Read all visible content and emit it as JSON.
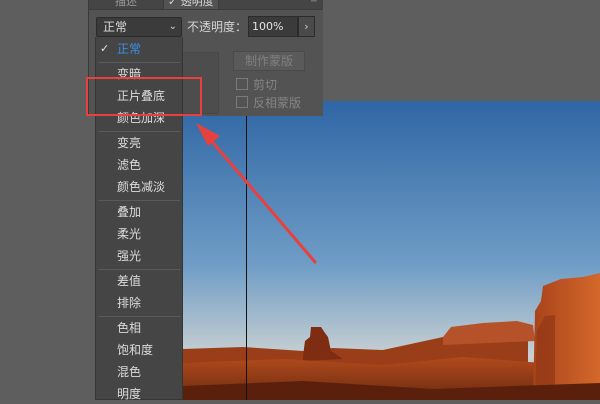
{
  "panel": {
    "tab_inactive": "描述",
    "tab_active": "透明度",
    "tab_active_check": "✓"
  },
  "blend": {
    "current": "正常",
    "arrow": "⌄"
  },
  "opacity": {
    "label": "不透明度：",
    "value": "100%",
    "button": "›"
  },
  "mask": {
    "make_mask": "制作蒙版",
    "clip": "剪切",
    "invert": "反相蒙版"
  },
  "menu": {
    "groups": [
      [
        "正常"
      ],
      [
        "变暗",
        "正片叠底",
        "颜色加深"
      ],
      [
        "变亮",
        "滤色",
        "颜色减淡"
      ],
      [
        "叠加",
        "柔光",
        "强光"
      ],
      [
        "差值",
        "排除"
      ],
      [
        "色相",
        "饱和度",
        "混色",
        "明度"
      ]
    ],
    "selected": "正常",
    "check": "✓"
  },
  "annotation": {
    "highlight_color": "#e8413d",
    "highlighted_item": "正片叠底"
  },
  "colors": {
    "app_bg": "#5f5f5f",
    "panel_bg": "#535353",
    "menu_bg": "#454545",
    "selected_text": "#3b8fe6"
  }
}
